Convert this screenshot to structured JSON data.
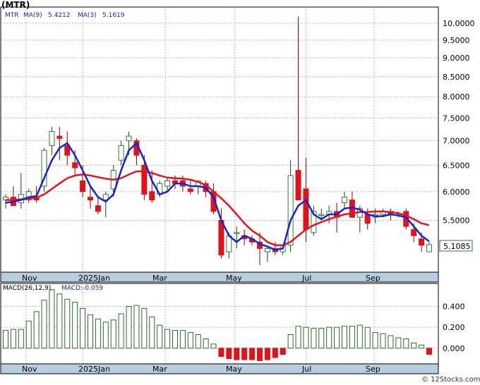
{
  "title": "(MTR)",
  "watermark": "© 12Stocks.com",
  "price_legend": {
    "ticker": "MTR",
    "ma9": "MA(9)",
    "ma9_value": "5.4212",
    "ma3": "MA(3)",
    "ma3_value": "5.1619"
  },
  "macd_legend": {
    "label": "MACD(26,12,9)",
    "value": "MACD:-0.059"
  },
  "last_price": "5.1085",
  "colors": {
    "up": "#2e7d32",
    "down": "#e0131a",
    "ma9": "#e8141b",
    "ma3": "#1525d6",
    "hist_pos": "#2e6b2e",
    "hist_neg": "#e0131a",
    "axis_band": "#b9cde0"
  },
  "chart_data": [
    {
      "type": "candlestick",
      "title": "(MTR)",
      "x_labels": [
        "Nov",
        "2025Jan",
        "Mar",
        "May",
        "Jul",
        "Sep"
      ],
      "y_ticks": [
        "10.0000",
        "9.5000",
        "9.0000",
        "8.5000",
        "8.0000",
        "7.5000",
        "7.0000",
        "6.5000",
        "6.0000",
        "5.5000"
      ],
      "y_scale": "log",
      "ylim": [
        4.7,
        10.5
      ],
      "grid": true,
      "series": [
        {
          "name": "MTR",
          "ohlc": [
            [
              5.85,
              5.95,
              5.7,
              5.9
            ],
            [
              5.9,
              6.1,
              5.75,
              5.75
            ],
            [
              5.8,
              6.35,
              5.7,
              5.95
            ],
            [
              5.85,
              6.05,
              5.8,
              6.0
            ],
            [
              5.9,
              6.1,
              5.8,
              5.85
            ],
            [
              6.1,
              6.85,
              6.0,
              6.8
            ],
            [
              6.9,
              7.3,
              6.7,
              7.2
            ],
            [
              7.1,
              7.3,
              6.6,
              7.05
            ],
            [
              6.9,
              7.2,
              6.5,
              6.7
            ],
            [
              6.55,
              6.8,
              6.3,
              6.45
            ],
            [
              6.2,
              6.5,
              5.9,
              6.0
            ],
            [
              5.9,
              6.1,
              5.7,
              5.85
            ],
            [
              5.75,
              5.9,
              5.6,
              5.65
            ],
            [
              5.85,
              6.0,
              5.55,
              5.95
            ],
            [
              6.05,
              6.5,
              5.9,
              6.4
            ],
            [
              6.6,
              7.0,
              6.5,
              6.9
            ],
            [
              7.0,
              7.2,
              6.7,
              7.1
            ],
            [
              7.0,
              7.05,
              6.5,
              6.7
            ],
            [
              6.5,
              6.7,
              5.85,
              5.95
            ],
            [
              6.0,
              6.4,
              5.8,
              5.85
            ],
            [
              5.95,
              6.2,
              5.9,
              6.15
            ],
            [
              6.1,
              6.25,
              6.0,
              6.2
            ],
            [
              6.2,
              6.3,
              6.05,
              6.15
            ],
            [
              6.2,
              6.3,
              6.0,
              6.1
            ],
            [
              6.05,
              6.2,
              5.95,
              6.0
            ],
            [
              6.1,
              6.2,
              5.95,
              6.2
            ],
            [
              6.15,
              6.2,
              5.9,
              6.0
            ],
            [
              6.0,
              6.15,
              5.6,
              5.65
            ],
            [
              5.5,
              5.7,
              4.9,
              4.95
            ],
            [
              5.0,
              5.3,
              4.9,
              5.25
            ],
            [
              5.3,
              5.4,
              5.05,
              5.3
            ],
            [
              5.25,
              5.35,
              5.1,
              5.2
            ],
            [
              5.2,
              5.25,
              5.1,
              5.15
            ],
            [
              5.15,
              5.3,
              4.8,
              5.05
            ],
            [
              5.0,
              5.1,
              4.85,
              5.05
            ],
            [
              5.05,
              5.15,
              4.95,
              5.0
            ],
            [
              5.0,
              5.1,
              4.95,
              5.1
            ],
            [
              5.1,
              6.6,
              5.0,
              6.3
            ],
            [
              6.4,
              10.2,
              5.85,
              5.85
            ],
            [
              6.05,
              6.65,
              5.15,
              5.35
            ],
            [
              5.3,
              5.75,
              5.25,
              5.65
            ],
            [
              5.6,
              5.7,
              5.5,
              5.6
            ],
            [
              5.6,
              5.75,
              5.45,
              5.65
            ],
            [
              5.65,
              5.8,
              5.3,
              5.55
            ],
            [
              5.8,
              6.0,
              5.7,
              5.9
            ],
            [
              5.85,
              6.0,
              5.55,
              5.55
            ],
            [
              5.55,
              5.75,
              5.3,
              5.7
            ],
            [
              5.6,
              5.7,
              5.35,
              5.45
            ],
            [
              5.55,
              5.7,
              5.45,
              5.6
            ],
            [
              5.6,
              5.7,
              5.55,
              5.65
            ],
            [
              5.65,
              5.7,
              5.5,
              5.6
            ],
            [
              5.6,
              5.65,
              5.55,
              5.6
            ],
            [
              5.65,
              5.7,
              5.35,
              5.4
            ],
            [
              5.35,
              5.45,
              5.15,
              5.25
            ],
            [
              5.2,
              5.3,
              5.0,
              5.1
            ],
            [
              5.0,
              5.15,
              5.0,
              5.11
            ]
          ]
        },
        {
          "name": "MA(9)",
          "values": [
            5.85,
            5.85,
            5.86,
            5.87,
            5.89,
            5.95,
            6.05,
            6.15,
            6.25,
            6.3,
            6.32,
            6.3,
            6.27,
            6.24,
            6.22,
            6.25,
            6.32,
            6.38,
            6.38,
            6.35,
            6.3,
            6.26,
            6.25,
            6.24,
            6.22,
            6.18,
            6.12,
            6.0,
            5.88,
            5.75,
            5.6,
            5.45,
            5.33,
            5.25,
            5.15,
            5.1,
            5.1,
            5.15,
            5.25,
            5.35,
            5.42,
            5.47,
            5.52,
            5.56,
            5.6,
            5.62,
            5.64,
            5.64,
            5.65,
            5.65,
            5.64,
            5.62,
            5.58,
            5.52,
            5.45,
            5.42
          ]
        },
        {
          "name": "MA(3)",
          "values": [
            5.8,
            5.82,
            5.85,
            5.9,
            5.92,
            6.25,
            6.6,
            6.85,
            6.95,
            6.7,
            6.4,
            6.1,
            5.9,
            5.82,
            5.95,
            6.4,
            6.8,
            6.95,
            6.6,
            6.2,
            5.95,
            6.0,
            6.15,
            6.15,
            6.1,
            6.1,
            6.07,
            5.9,
            5.5,
            5.25,
            5.15,
            5.25,
            5.2,
            5.12,
            5.08,
            5.03,
            5.05,
            5.5,
            5.75,
            5.85,
            5.6,
            5.52,
            5.6,
            5.6,
            5.7,
            5.72,
            5.68,
            5.6,
            5.57,
            5.57,
            5.6,
            5.58,
            5.55,
            5.4,
            5.25,
            5.16
          ]
        }
      ]
    },
    {
      "type": "bar",
      "title": "MACD(26,12,9)",
      "y_ticks": [
        "0.400",
        "0.200",
        "0.000"
      ],
      "ylim": [
        -0.15,
        0.62
      ],
      "x_labels": [
        "Nov",
        "2025Jan",
        "Mar",
        "May",
        "Jul",
        "Sep"
      ],
      "series": [
        {
          "name": "MACD",
          "values": [
            0.17,
            0.18,
            0.18,
            0.26,
            0.35,
            0.46,
            0.56,
            0.52,
            0.47,
            0.44,
            0.38,
            0.32,
            0.28,
            0.25,
            0.27,
            0.33,
            0.4,
            0.41,
            0.38,
            0.3,
            0.22,
            0.18,
            0.17,
            0.17,
            0.15,
            0.13,
            0.09,
            0.04,
            -0.08,
            -0.1,
            -0.11,
            -0.11,
            -0.11,
            -0.12,
            -0.11,
            -0.09,
            -0.06,
            0.13,
            0.21,
            0.2,
            0.19,
            0.19,
            0.2,
            0.2,
            0.21,
            0.21,
            0.22,
            0.2,
            0.15,
            0.14,
            0.12,
            0.1,
            0.09,
            0.05,
            0.03,
            -0.059
          ]
        }
      ]
    }
  ]
}
